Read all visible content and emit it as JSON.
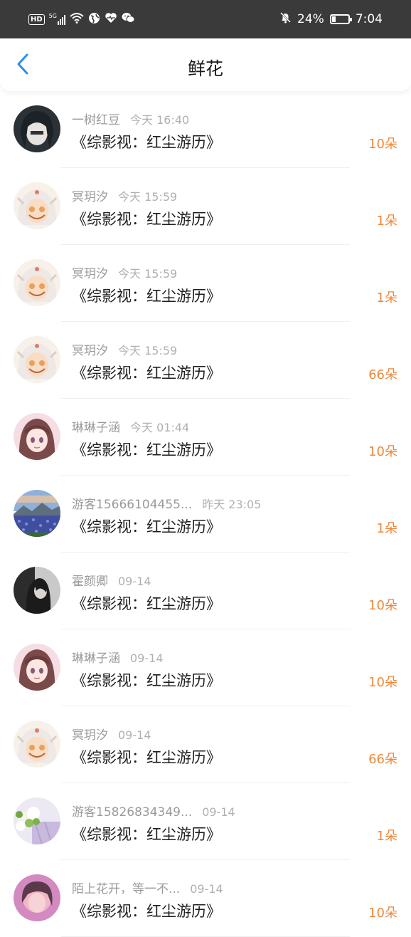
{
  "status_bar": {
    "network_label": "HD",
    "signal_label": "5G",
    "battery_percent": "24%",
    "battery_level": 0.24,
    "time": "7:04"
  },
  "header": {
    "title": "鲜花",
    "back_icon": "chevron-left-icon"
  },
  "colors": {
    "accent_blue": "#2b8ef0",
    "count_orange": "#f0873a"
  },
  "items": [
    {
      "user": "一树红豆",
      "time": "今天 16:40",
      "book": "《综影视：红尘游历》",
      "count": "10朵",
      "avatar": "avatar-dark-hair"
    },
    {
      "user": "冥玥汐",
      "time": "今天 15:59",
      "book": "《综影视：红尘游历》",
      "count": "1朵",
      "avatar": "avatar-anime-white"
    },
    {
      "user": "冥玥汐",
      "time": "今天 15:59",
      "book": "《综影视：红尘游历》",
      "count": "1朵",
      "avatar": "avatar-anime-white"
    },
    {
      "user": "冥玥汐",
      "time": "今天 15:59",
      "book": "《综影视：红尘游历》",
      "count": "66朵",
      "avatar": "avatar-anime-white"
    },
    {
      "user": "琳琳子涵",
      "time": "今天 01:44",
      "book": "《综影视：红尘游历》",
      "count": "10朵",
      "avatar": "avatar-anime-pink"
    },
    {
      "user": "游客15666104455...",
      "time": "昨天 23:05",
      "book": "《综影视：红尘游历》",
      "count": "1朵",
      "avatar": "avatar-landscape"
    },
    {
      "user": "霍颜卿",
      "time": "09-14",
      "book": "《综影视：红尘游历》",
      "count": "10朵",
      "avatar": "avatar-dark-photo"
    },
    {
      "user": "琳琳子涵",
      "time": "09-14",
      "book": "《综影视：红尘游历》",
      "count": "10朵",
      "avatar": "avatar-anime-pink"
    },
    {
      "user": "冥玥汐",
      "time": "09-14",
      "book": "《综影视：红尘游历》",
      "count": "66朵",
      "avatar": "avatar-anime-white"
    },
    {
      "user": "游客15826834349...",
      "time": "09-14",
      "book": "《综影视：红尘游历》",
      "count": "1朵",
      "avatar": "avatar-flowers"
    },
    {
      "user": "陌上花开，等一不...",
      "time": "09-14",
      "book": "《综影视：红尘游历》",
      "count": "10朵",
      "avatar": "avatar-pink-photo"
    }
  ]
}
